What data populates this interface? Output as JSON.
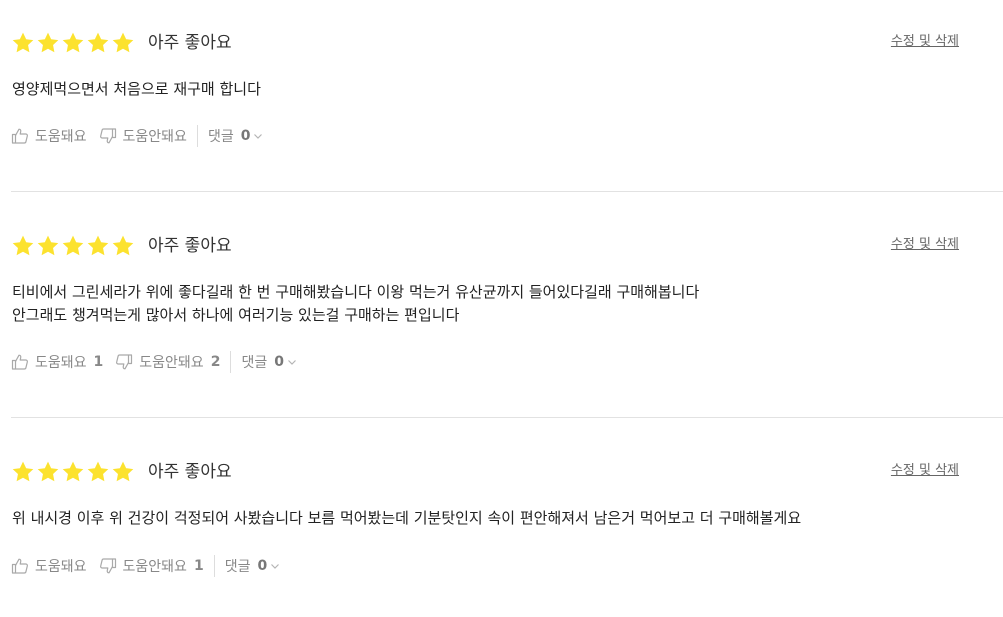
{
  "colors": {
    "star": "#FCE22E",
    "divider": "#E2E2E2",
    "muted": "#888888"
  },
  "reviews": [
    {
      "rating_label": "아주 좋아요",
      "edit_label": "수정 및 삭제",
      "lines": [
        "영양제먹으면서 처음으로 재구매 합니다"
      ],
      "helpful_label": "도움돼요",
      "helpful_count": "",
      "not_helpful_label": "도움안돼요",
      "not_helpful_count": "",
      "reply_label": "댓글",
      "reply_count": "0"
    },
    {
      "rating_label": "아주 좋아요",
      "edit_label": "수정 및 삭제",
      "lines": [
        "티비에서 그린세라가 위에 좋다길래 한 번 구매해봤습니다 이왕 먹는거 유산균까지 들어있다길래 구매해봅니다",
        "안그래도 챙겨먹는게 많아서 하나에 여러기능 있는걸 구매하는 편입니다"
      ],
      "helpful_label": "도움돼요",
      "helpful_count": "1",
      "not_helpful_label": "도움안돼요",
      "not_helpful_count": "2",
      "reply_label": "댓글",
      "reply_count": "0"
    },
    {
      "rating_label": "아주 좋아요",
      "edit_label": "수정 및 삭제",
      "lines": [
        "위 내시경 이후 위 건강이 걱정되어 사봤습니다 보름 먹어봤는데 기분탓인지 속이 편안해져서 남은거 먹어보고 더 구매해볼게요"
      ],
      "helpful_label": "도움돼요",
      "helpful_count": "",
      "not_helpful_label": "도움안돼요",
      "not_helpful_count": "1",
      "reply_label": "댓글",
      "reply_count": "0"
    }
  ]
}
